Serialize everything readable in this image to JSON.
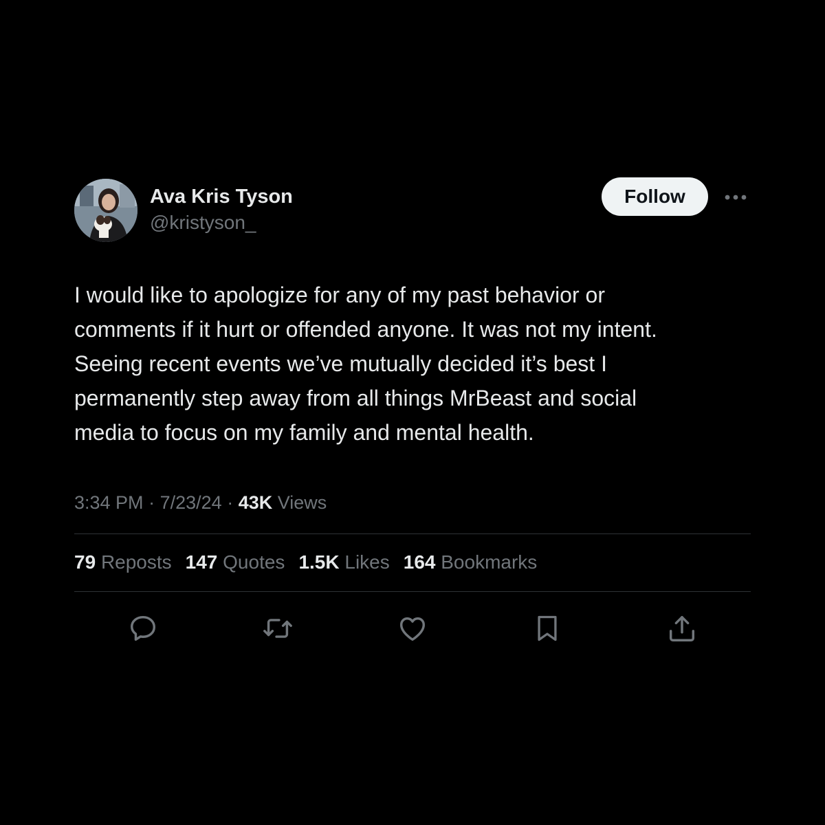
{
  "author": {
    "display_name": "Ava Kris Tyson",
    "handle": "@kristyson_"
  },
  "header": {
    "follow_label": "Follow",
    "more_icon": "more-horizontal-icon"
  },
  "tweet": {
    "text": "I would like to apologize for any of my past behavior or\ncomments if it hurt or offended anyone. It was not my intent.\nSeeing recent events we’ve mutually decided it’s best I\npermanently step away from all things MrBeast and social\nmedia to focus on my family and mental health.",
    "time": "3:34 PM",
    "separator": "·",
    "date": "7/23/24",
    "views_count": "43K",
    "views_label": "Views"
  },
  "stats": [
    {
      "count": "79",
      "label": "Reposts"
    },
    {
      "count": "147",
      "label": "Quotes"
    },
    {
      "count": "1.5K",
      "label": "Likes"
    },
    {
      "count": "164",
      "label": "Bookmarks"
    }
  ],
  "actions": {
    "reply_icon": "reply-icon",
    "repost_icon": "repost-icon",
    "like_icon": "heart-icon",
    "bookmark_icon": "bookmark-icon",
    "share_icon": "share-icon"
  },
  "colors": {
    "background": "#000000",
    "primary_text": "#e7e9ea",
    "secondary_text": "#71767b",
    "divider": "#2f3336",
    "follow_bg": "#eff3f4"
  }
}
